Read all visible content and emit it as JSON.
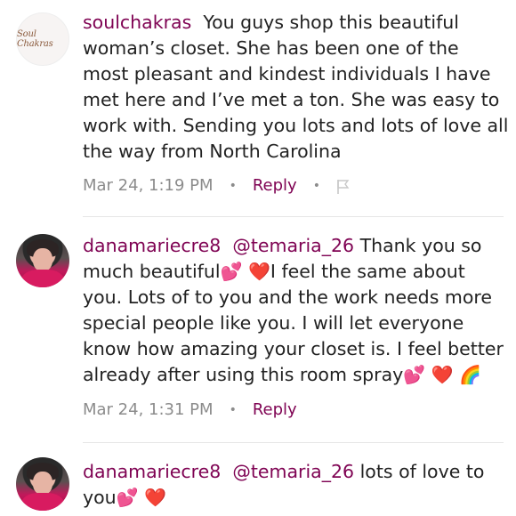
{
  "comments": [
    {
      "username": "soulchakras",
      "logo_text": "Soul Chakras",
      "body": "You guys shop this beautiful woman’s closet. She has been one of the most pleasant and kindest individuals I have met here and I’ve met a ton. She was easy to work with. Sending you lots and lots of love all the way from North Carolina",
      "timestamp": "Mar 24, 1:19 PM",
      "reply_label": "Reply",
      "separator": "•"
    },
    {
      "username": "danamariecre8",
      "mention": "@temaria_26",
      "body_part1": "Thank you so much beautiful",
      "body_part2": "I feel the same about you. Lots of to you and the work needs more special people like you. I will let everyone know how amazing your closet is. I feel better already after using this room spray",
      "timestamp": "Mar 24, 1:31 PM",
      "reply_label": "Reply",
      "separator": "•"
    },
    {
      "username": "danamariecre8",
      "mention": "@temaria_26",
      "body": "lots of love to you"
    }
  ],
  "emoji": {
    "sparkling_heart": "💕",
    "red_heart": "❤️",
    "rainbow": "🌈"
  },
  "colors": {
    "username": "#7f0353",
    "reply": "#7f0353",
    "meta": "#8c8c8c",
    "text": "#222222"
  }
}
